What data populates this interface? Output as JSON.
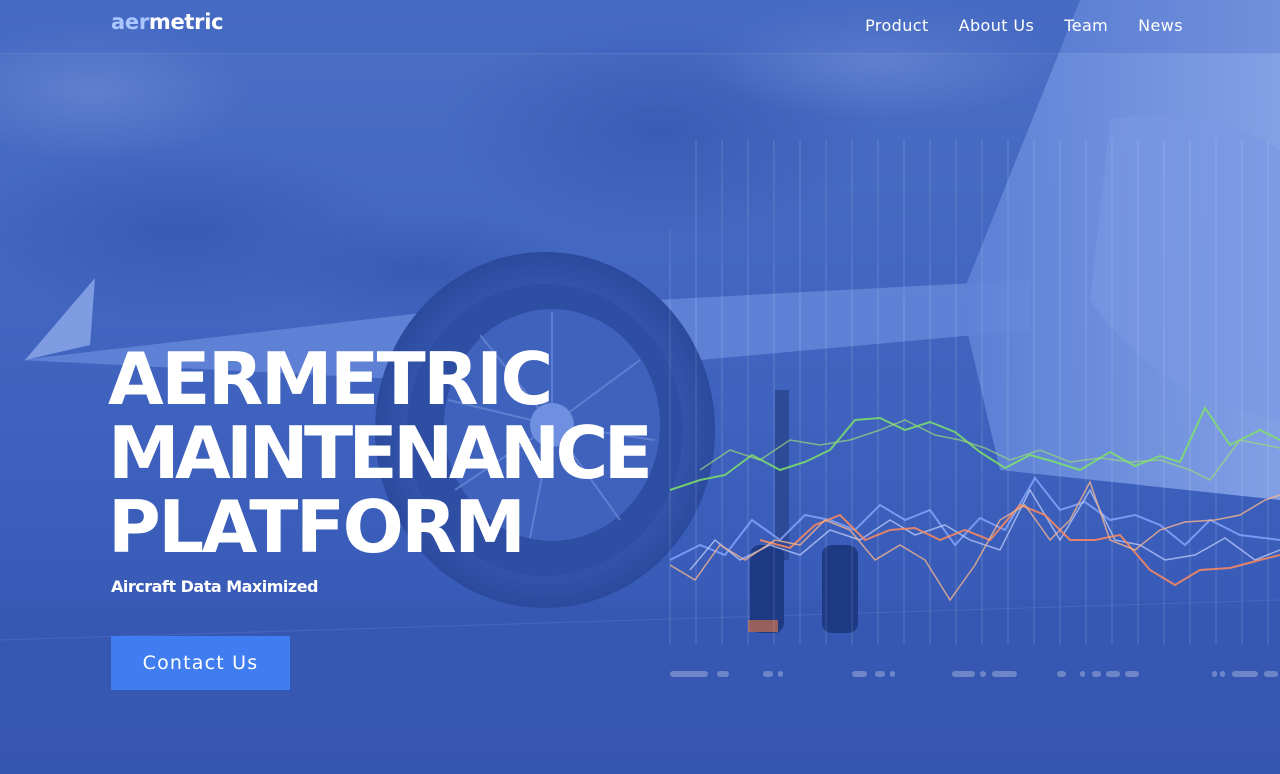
{
  "brand": {
    "logo_part1": "aer",
    "logo_part2": "metric",
    "colors": {
      "accent": "#3f7df0",
      "logo_light": "#a9c6ff",
      "overlay": "#4266c0"
    }
  },
  "nav": {
    "items": [
      {
        "label": "Product"
      },
      {
        "label": "About Us"
      },
      {
        "label": "Team"
      },
      {
        "label": "News"
      }
    ]
  },
  "hero": {
    "headline_line1": "AERMETRIC",
    "headline_line2": "MAINTENANCE",
    "headline_line3": "PLATFORM",
    "subheadline": "Aircraft Data Maximized",
    "cta_label": "Contact Us"
  },
  "background": {
    "image": "airplane-photo-with-blue-overlay",
    "graphic": "decorative-line-chart",
    "series_colors": [
      "#7fe06a",
      "#8aa8ff",
      "#c7d6ff",
      "#ff8a5c",
      "#f5b48c"
    ]
  }
}
